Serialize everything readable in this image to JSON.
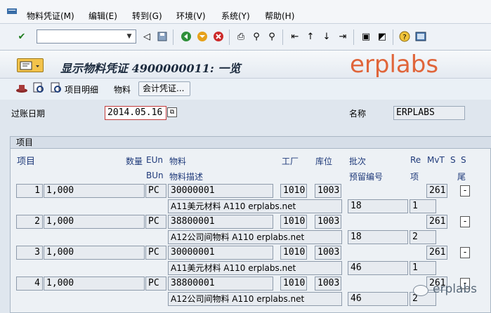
{
  "menu": {
    "items": [
      "物料凭证(M)",
      "编辑(E)",
      "转到(G)",
      "环境(V)",
      "系统(Y)",
      "帮助(H)"
    ]
  },
  "toolbar": {
    "command_field_value": "",
    "icons": [
      "enter-check-icon",
      "back-arrow-icon",
      "save-icon",
      "back-icon",
      "exit-icon",
      "cancel-icon",
      "print-icon",
      "find-icon",
      "find-next-icon",
      "first-page-icon",
      "prev-page-icon",
      "next-page-icon",
      "last-page-icon",
      "new-session-icon",
      "shortcut-icon",
      "help-icon",
      "layout-menu-icon"
    ]
  },
  "title": {
    "text": "显示物料凭证 4900000011: 一览"
  },
  "watermark": {
    "text": "erplabs",
    "color": "#e0653a"
  },
  "app_toolbar": {
    "item_detail": "项目明细",
    "material": "物料",
    "accounting_docs": "会计凭证..."
  },
  "header": {
    "posting_date_label": "过账日期",
    "posting_date_value": "2014.05.16",
    "name_label": "名称",
    "name_value": "ERPLABS"
  },
  "items_panel": {
    "title": "项目",
    "col_headers": {
      "item": "项目",
      "qty": "数量",
      "eun": "EUn",
      "material": "物料",
      "plant": "工厂",
      "sloc": "库位",
      "batch": "批次",
      "re": "Re",
      "mvt": "MvT",
      "s1": "S",
      "s2": "S",
      "bun": "BUn",
      "mat_desc": "物料描述",
      "reservation": "预留编号",
      "item2": "项",
      "tail": "尾"
    },
    "rows": [
      {
        "item": "1",
        "qty": "1,000",
        "eun": "PC",
        "material": "30000001",
        "plant": "1010",
        "sloc": "1003",
        "mvt": "261",
        "s": "-",
        "desc": "A11美元材料 A110 erplabs.net",
        "reservation": "18",
        "res_item": "1"
      },
      {
        "item": "2",
        "qty": "1,000",
        "eun": "PC",
        "material": "38800001",
        "plant": "1010",
        "sloc": "1003",
        "mvt": "261",
        "s": "-",
        "desc": "A12公司间物料 A110 erplabs.net",
        "reservation": "18",
        "res_item": "2"
      },
      {
        "item": "3",
        "qty": "1,000",
        "eun": "PC",
        "material": "30000001",
        "plant": "1010",
        "sloc": "1003",
        "mvt": "261",
        "s": "-",
        "desc": "A11美元材料 A110 erplabs.net",
        "reservation": "46",
        "res_item": "1"
      },
      {
        "item": "4",
        "qty": "1,000",
        "eun": "PC",
        "material": "38800001",
        "plant": "1010",
        "sloc": "1003",
        "mvt": "261",
        "s": "-",
        "desc": "A12公司间物料 A110 erplabs.net",
        "reservation": "46",
        "res_item": "2"
      }
    ]
  },
  "footer_watermark": {
    "text": "erplabs"
  }
}
